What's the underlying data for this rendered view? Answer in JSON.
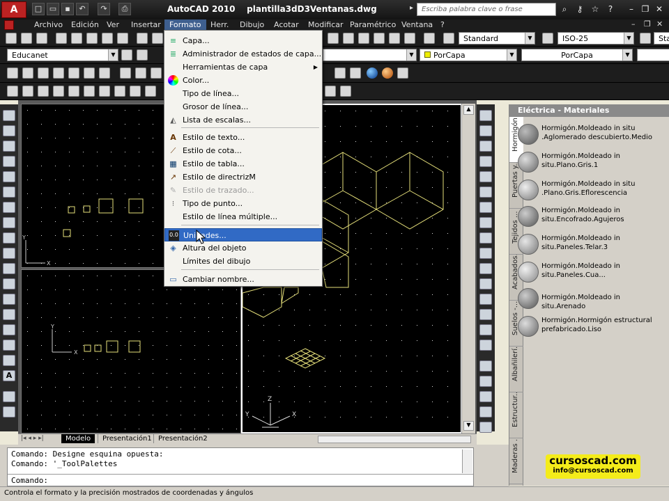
{
  "title_bar": {
    "title": "AutoCAD 2010    plantilla3dD3Ventanas.dwg",
    "search_placeholder": "Escriba palabra clave o frase",
    "quick_access_icons": [
      "new-file-icon",
      "open-icon",
      "save-icon",
      "undo-icon",
      "redo-icon",
      "plot-icon"
    ],
    "info_icons": [
      "binoculars-icon",
      "key-icon",
      "star-icon",
      "help-icon"
    ]
  },
  "menu_bar": {
    "items": [
      "Archivo",
      "Edición",
      "Ver",
      "Insertar",
      "Formato",
      "Herr.",
      "Dibujo",
      "Acotar",
      "Modificar",
      "Paramétrico",
      "Ventana",
      "?"
    ],
    "active": "Formato"
  },
  "toolbars": {
    "text_style": "Standard",
    "dim_style": "ISO-25",
    "workspace": "Educanet",
    "color": "PorCapa",
    "linetype": "PorCapa",
    "table_style_partial": "Stan"
  },
  "format_menu": {
    "items": [
      {
        "label": "Capa...",
        "icon": "layers-icon",
        "state": "normal"
      },
      {
        "label": "Administrador de estados de capa...",
        "icon": "layer-states-icon",
        "state": "normal"
      },
      {
        "label": "Herramientas de capa",
        "icon": "",
        "state": "submenu"
      },
      {
        "label": "Color...",
        "icon": "color-wheel-icon",
        "state": "normal"
      },
      {
        "label": "Tipo de línea...",
        "icon": "",
        "state": "normal"
      },
      {
        "label": "Grosor de línea...",
        "icon": "",
        "state": "normal"
      },
      {
        "label": "Lista de escalas...",
        "icon": "scale-list-icon",
        "state": "normal"
      },
      {
        "label": "Estilo de texto...",
        "icon": "text-style-icon",
        "state": "normal"
      },
      {
        "label": "Estilo de cota...",
        "icon": "dimension-style-icon",
        "state": "normal"
      },
      {
        "label": "Estilo de tabla...",
        "icon": "table-style-icon",
        "state": "normal"
      },
      {
        "label": "Estilo de directrizM",
        "icon": "multileader-icon",
        "state": "normal"
      },
      {
        "label": "Estilo de trazado...",
        "icon": "plot-style-icon",
        "state": "disabled"
      },
      {
        "label": "Tipo de punto...",
        "icon": "point-style-icon",
        "state": "normal"
      },
      {
        "label": "Estilo de línea múltiple...",
        "icon": "",
        "state": "normal"
      },
      {
        "label": "Unidades...",
        "icon": "units-icon",
        "state": "highlighted"
      },
      {
        "label": "Altura del objeto",
        "icon": "thickness-icon",
        "state": "normal"
      },
      {
        "label": "Límites del dibujo",
        "icon": "",
        "state": "normal"
      },
      {
        "label": "Cambiar nombre...",
        "icon": "rename-icon",
        "state": "normal"
      }
    ]
  },
  "layout_tabs": [
    "Modelo",
    "Presentación1",
    "Presentación2"
  ],
  "tool_palette": {
    "title": "Eléctrica - Materiales",
    "tabs": [
      "Hormigón",
      "Puertas y...",
      "Tejidos ...",
      "Acabados...",
      "Suelos -...",
      "Albañilerí...",
      "Estructur...",
      "Maderas ..."
    ],
    "items": [
      "Hormigón.Moldeado in situ .Aglomerado descubierto.Medio",
      "Hormigón.Moldeado in situ.Plano.Gris.1",
      "Hormigón.Moldeado in situ .Plano.Gris.Eflorescencia",
      "Hormigón.Moldeado in situ.Encofrado.Agujeros",
      "Hormigón.Moldeado in situ.Paneles.Telar.3",
      "Hormigón.Moldeado in situ.Paneles.Cua...",
      "Hormigón.Moldeado in situ.Arenado",
      "Hormigón.Hormigón estructural prefabricado.Liso"
    ]
  },
  "command_window": {
    "lines": [
      "Comando: Designe esquina opuesta:",
      "Comando: '_ToolPalettes",
      ""
    ],
    "prompt": "Comando:"
  },
  "logo": {
    "brand": "cursoscad.com",
    "email": "info@cursoscad.com"
  },
  "status_bar": "Controla el formato y la precisión mostrados de coordenadas y ángulos",
  "viewport_axes": {
    "x": "X",
    "y": "Y",
    "z": "Z"
  },
  "colors": {
    "highlight": "#316ac5",
    "titlebar": "#1c1c1c",
    "logo_yellow": "#f4ec1a",
    "drawing_lines": "#e6e07a"
  }
}
